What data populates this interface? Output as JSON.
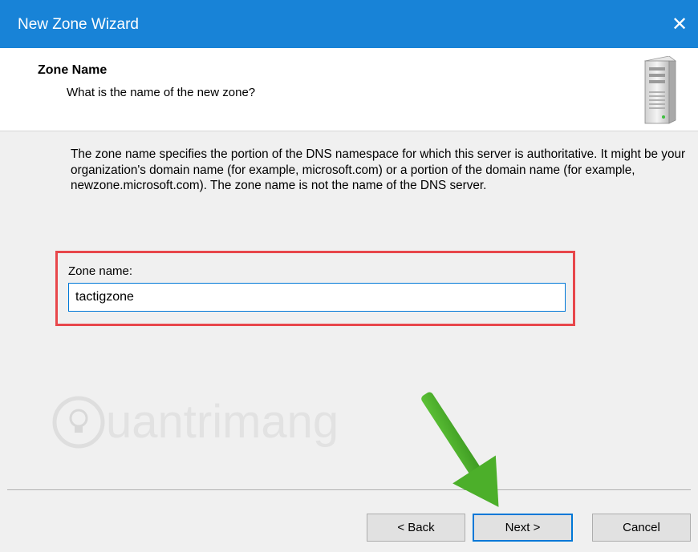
{
  "window": {
    "title": "New Zone Wizard",
    "close_glyph": "✕"
  },
  "header": {
    "title": "Zone Name",
    "subtitle": "What is the name of the new zone?",
    "icon": "server-icon"
  },
  "body": {
    "description": "The zone name specifies the portion of the DNS namespace for which this server is authoritative. It might be your organization's domain name (for example,  microsoft.com) or a portion of the domain name (for example, newzone.microsoft.com). The zone name is not the name of the DNS server.",
    "zone_name_label": "Zone name:",
    "zone_name_value": "tactigzone"
  },
  "watermark": {
    "text": "uantrimang"
  },
  "buttons": {
    "back": "< Back",
    "next": "Next >",
    "cancel": "Cancel"
  },
  "colors": {
    "titlebar": "#1883d7",
    "highlight_box": "#e8474b",
    "annotation_arrow": "#4caf2a",
    "focus": "#0078d7"
  }
}
